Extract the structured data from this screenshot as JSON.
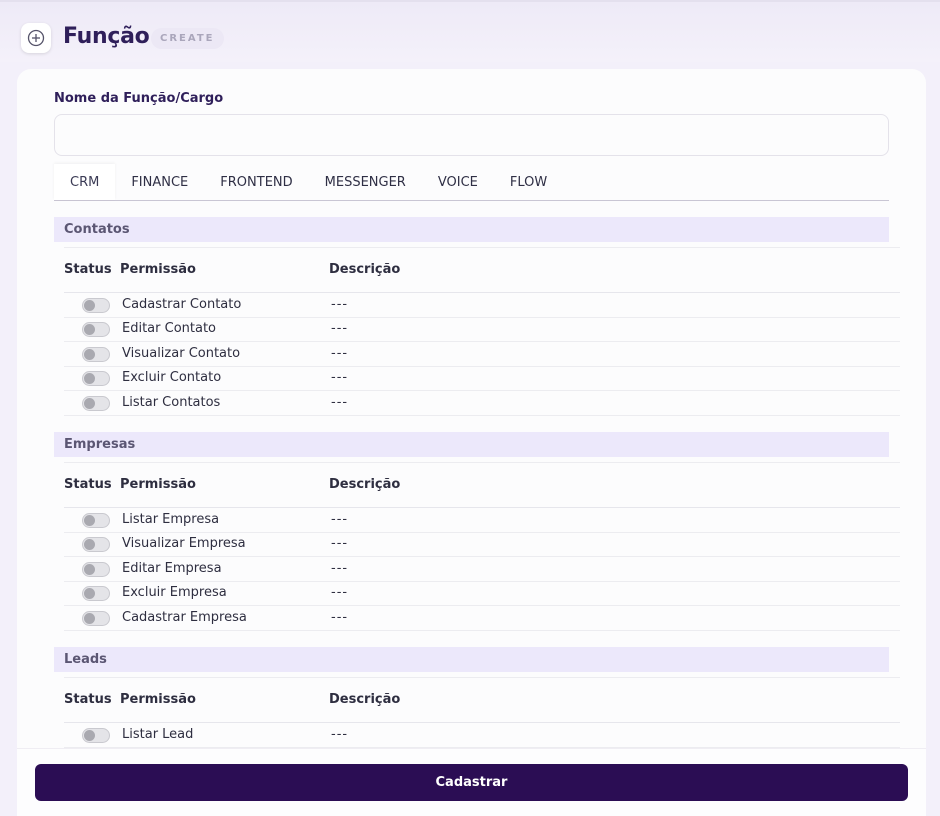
{
  "header": {
    "title": "Função",
    "mode_badge": "CREATE",
    "icon": "plus-circle-icon"
  },
  "form": {
    "name_label": "Nome da Função/Cargo",
    "name_value": "",
    "name_placeholder": ""
  },
  "tabs": [
    {
      "label": "CRM",
      "active": true
    },
    {
      "label": "FINANCE",
      "active": false
    },
    {
      "label": "FRONTEND",
      "active": false
    },
    {
      "label": "MESSENGER",
      "active": false
    },
    {
      "label": "VOICE",
      "active": false
    },
    {
      "label": "FLOW",
      "active": false
    }
  ],
  "columns": {
    "status": "Status",
    "permission": "Permissão",
    "description": "Descrição"
  },
  "sections": [
    {
      "title": "Contatos",
      "rows": [
        {
          "permission": "Cadastrar Contato",
          "description": "---",
          "enabled": false
        },
        {
          "permission": "Editar Contato",
          "description": "---",
          "enabled": false
        },
        {
          "permission": "Visualizar Contato",
          "description": "---",
          "enabled": false
        },
        {
          "permission": "Excluir Contato",
          "description": "---",
          "enabled": false
        },
        {
          "permission": "Listar Contatos",
          "description": "---",
          "enabled": false
        }
      ]
    },
    {
      "title": "Empresas",
      "rows": [
        {
          "permission": "Listar Empresa",
          "description": "---",
          "enabled": false
        },
        {
          "permission": "Visualizar Empresa",
          "description": "---",
          "enabled": false
        },
        {
          "permission": "Editar Empresa",
          "description": "---",
          "enabled": false
        },
        {
          "permission": "Excluir Empresa",
          "description": "---",
          "enabled": false
        },
        {
          "permission": "Cadastrar Empresa",
          "description": "---",
          "enabled": false
        }
      ]
    },
    {
      "title": "Leads",
      "rows": [
        {
          "permission": "Listar Lead",
          "description": "---",
          "enabled": false
        }
      ]
    }
  ],
  "footer": {
    "submit_label": "Cadastrar"
  },
  "colors": {
    "primary": "#2b0d54",
    "section_bg": "#ece8fb",
    "title": "#2f1f5a"
  }
}
